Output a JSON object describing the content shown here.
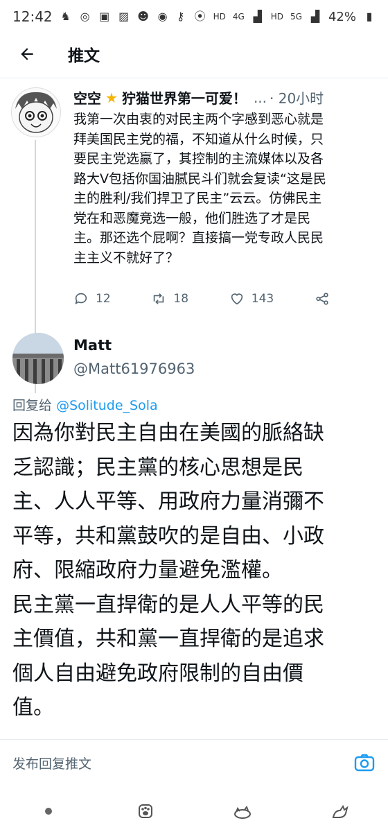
{
  "status_bar": {
    "time": "12:42",
    "net1": "HD",
    "net2": "4G",
    "net3": "HD",
    "net4": "5G",
    "battery": "42%"
  },
  "header": {
    "title": "推文"
  },
  "parent_tweet": {
    "name": "空空",
    "name_suffix": "狞猫世界第一可爱！",
    "ellipsis": "...",
    "time": "· 20小时",
    "body_lines": [
      "我第一次由衷的对民主两个字感到恶心就是",
      "拜美国民主党的福，不知道从什么时候，只",
      "要民主党选赢了，其控制的主流媒体以及各",
      "路大V包括你国油腻民斗们就会复读“这是民",
      "主的胜利/我们捍卫了民主”云云。仿佛民主",
      "党在和恶魔竞选一般，他们胜选了才是民",
      "主。那还选个屁啊？直接搞一党专政人民民",
      "主主义不就好了？"
    ],
    "reply_count": "12",
    "retweet_count": "18",
    "like_count": "143"
  },
  "reply_tweet": {
    "name": "Matt",
    "handle": "@Matt61976963",
    "reply_to_label": "回复给",
    "reply_to_mention": "@Solitude_Sola",
    "body_lines": [
      "因為你對民主自由在美國的脈絡缺",
      "乏認識；民主黨的核心思想是民",
      "主、人人平等、用政府力量消彌不",
      "平等，共和黨鼓吹的是自由、小政",
      "府、限縮政府力量避免濫權。",
      "民主黨一直捍衛的是人人平等的民",
      "主價值，共和黨一直捍衛的是追求",
      "個人自由避免政府限制的自由價",
      "值。"
    ]
  },
  "compose": {
    "placeholder": "发布回复推文"
  },
  "colors": {
    "accent": "#1d9bf0",
    "text": "#0f1419",
    "secondary": "#536471",
    "star": "#f4b400"
  }
}
